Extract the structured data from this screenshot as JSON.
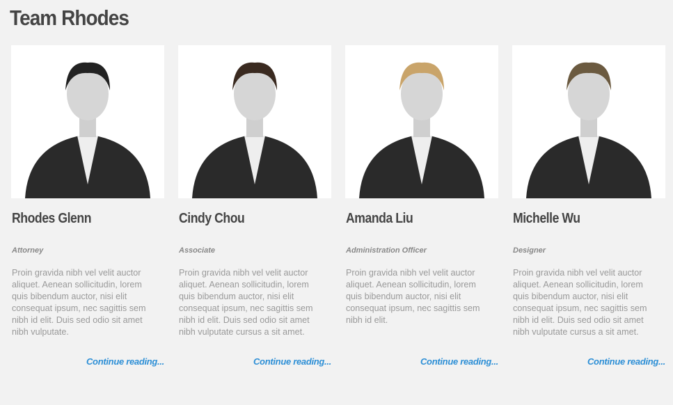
{
  "title": "Team Rhodes",
  "members": [
    {
      "name": "Rhodes Glenn",
      "role": "Attorney",
      "bio": [
        "Proin gravida nibh vel velit auctor",
        "aliquet. Aenean sollicitudin, lorem",
        "quis bibendum auctor, nisi elit",
        "consequat ipsum, nec sagittis sem",
        "nibh id elit. Duis sed odio sit amet",
        "nibh vulputate."
      ],
      "link": "Continue reading..."
    },
    {
      "name": "Cindy Chou",
      "role": "Associate",
      "bio": [
        "Proin gravida nibh vel velit auctor",
        "aliquet. Aenean sollicitudin, lorem",
        "quis bibendum auctor, nisi elit",
        "consequat ipsum, nec sagittis sem",
        "nibh id elit. Duis sed odio sit amet",
        "nibh vulputate cursus a sit amet."
      ],
      "link": "Continue reading..."
    },
    {
      "name": "Amanda Liu",
      "role": "Administration Officer",
      "bio": [
        "Proin gravida nibh vel velit auctor",
        "aliquet. Aenean sollicitudin, lorem",
        "quis bibendum auctor, nisi elit",
        "consequat ipsum, nec sagittis sem",
        "nibh id elit."
      ],
      "link": "Continue reading..."
    },
    {
      "name": "Michelle Wu",
      "role": "Designer",
      "bio": [
        "Proin gravida nibh vel velit auctor",
        "aliquet. Aenean sollicitudin, lorem",
        "quis bibendum auctor, nisi elit",
        "consequat ipsum, nec sagittis sem",
        "nibh id elit. Duis sed odio sit amet",
        "nibh vulputate cursus a sit amet."
      ],
      "link": "Continue reading..."
    }
  ]
}
